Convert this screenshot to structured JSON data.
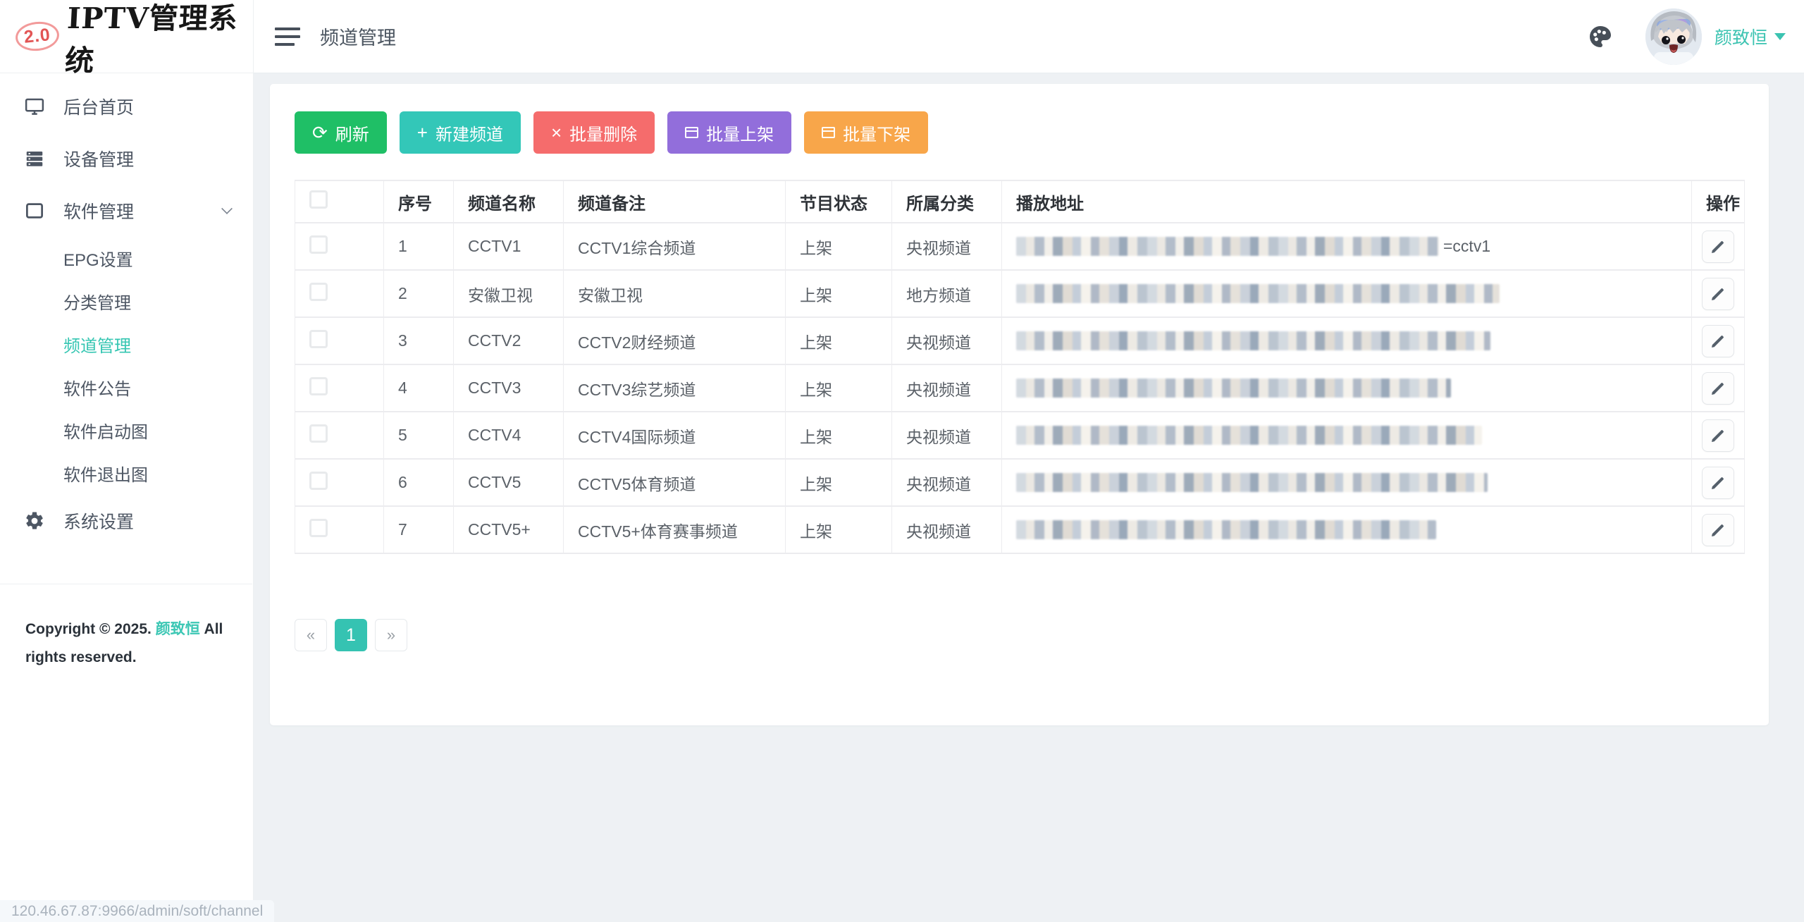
{
  "logo": {
    "badge": "2.0",
    "title": "IPTV管理系统"
  },
  "topbar": {
    "page_title": "频道管理",
    "username": "颜致恒",
    "palette_icon": "theme-palette",
    "avatar": "anime-avatar"
  },
  "sidebar": {
    "items": [
      {
        "label": "后台首页",
        "icon": "monitor"
      },
      {
        "label": "设备管理",
        "icon": "server"
      },
      {
        "label": "软件管理",
        "icon": "window",
        "expanded": true,
        "children": [
          "EPG设置",
          "分类管理",
          "频道管理",
          "软件公告",
          "软件启动图",
          "软件退出图"
        ],
        "active_child": "频道管理"
      },
      {
        "label": "系统设置",
        "icon": "gear"
      }
    ],
    "copyright": {
      "prefix": "Copyright © 2025.",
      "owner": "颜致恒",
      "suffix": "All rights reserved."
    }
  },
  "toolbar": {
    "buttons": [
      {
        "label": "刷新",
        "icon": "refresh",
        "glyph": "⟳",
        "color": "#1fbf66"
      },
      {
        "label": "新建频道",
        "icon": "plus",
        "glyph": "+",
        "color": "#33c7b8"
      },
      {
        "label": "批量删除",
        "icon": "close",
        "glyph": "×",
        "color": "#f56c6c"
      },
      {
        "label": "批量上架",
        "icon": "box",
        "glyph": "",
        "color": "#926edb"
      },
      {
        "label": "批量下架",
        "icon": "box",
        "glyph": "",
        "color": "#f8a64a"
      }
    ]
  },
  "table": {
    "headers": [
      "",
      "序号",
      "频道名称",
      "频道备注",
      "节目状态",
      "所属分类",
      "播放地址",
      "操作"
    ],
    "rows": [
      {
        "index": 1,
        "name": "CCTV1",
        "note": "CCTV1综合频道",
        "status": "上架",
        "category": "央视频道",
        "url_masked": true,
        "mask_width": 600,
        "url_suffix": "=cctv1"
      },
      {
        "index": 2,
        "name": "安徽卫视",
        "note": "安徽卫视",
        "status": "上架",
        "category": "地方频道",
        "url_masked": true,
        "mask_width": 686,
        "url_suffix": ""
      },
      {
        "index": 3,
        "name": "CCTV2",
        "note": "CCTV2财经频道",
        "status": "上架",
        "category": "央视频道",
        "url_masked": true,
        "mask_width": 673,
        "url_suffix": ""
      },
      {
        "index": 4,
        "name": "CCTV3",
        "note": "CCTV3综艺频道",
        "status": "上架",
        "category": "央视频道",
        "url_masked": true,
        "mask_width": 617,
        "url_suffix": ""
      },
      {
        "index": 5,
        "name": "CCTV4",
        "note": "CCTV4国际频道",
        "status": "上架",
        "category": "央视频道",
        "url_masked": true,
        "mask_width": 661,
        "url_suffix": ""
      },
      {
        "index": 6,
        "name": "CCTV5",
        "note": "CCTV5体育频道",
        "status": "上架",
        "category": "央视频道",
        "url_masked": true,
        "mask_width": 669,
        "url_suffix": ""
      },
      {
        "index": 7,
        "name": "CCTV5+",
        "note": "CCTV5+体育赛事频道",
        "status": "上架",
        "category": "央视频道",
        "url_masked": true,
        "mask_width": 596,
        "url_suffix": ""
      }
    ]
  },
  "pagination": {
    "prev": "«",
    "current": "1",
    "next": "»"
  },
  "statusbar": {
    "url": "120.46.67.87:9966/admin/soft/channel"
  },
  "colors": {
    "accent_teal": "#35c3b2",
    "status_green": "#2bc36f",
    "link_teal": "#3cc7b4",
    "btn_green": "#1fbf66",
    "btn_teal": "#33c7b8",
    "btn_red": "#f56c6c",
    "btn_purple": "#926edb",
    "btn_orange": "#f8a64a"
  }
}
